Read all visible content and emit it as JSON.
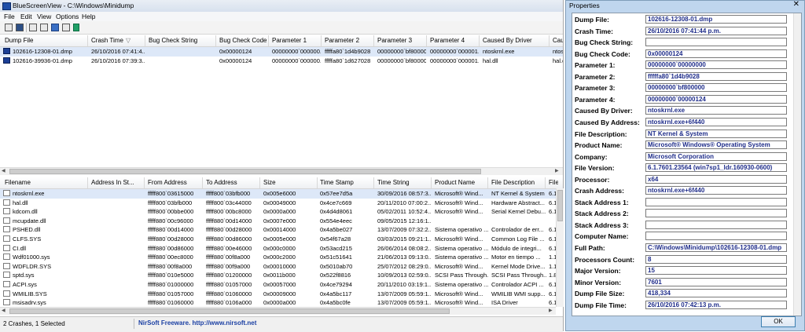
{
  "main_window": {
    "title": "BlueScreenView  -  C:\\Windows\\Minidump",
    "menu": [
      "File",
      "Edit",
      "View",
      "Options",
      "Help"
    ],
    "toolbar_icons": [
      "properties-icon",
      "save-icon",
      "html-report-icon",
      "copy-icon",
      "copy-files-icon",
      "refresh-icon",
      "exit-icon"
    ]
  },
  "crash_list": {
    "columns": [
      "Dump File",
      "Crash Time",
      "Bug Check String",
      "Bug Check Code",
      "Parameter 1",
      "Parameter 2",
      "Parameter 3",
      "Parameter 4",
      "Caused By Driver",
      "Caus"
    ],
    "rows": [
      [
        "102616-12308-01.dmp",
        "26/10/2016 07:41:4...",
        "",
        "0x00000124",
        "00000000`000000...",
        "fffffa80`1d4b9028",
        "00000000`bf800000",
        "00000000`000001...",
        "ntoskrnl.exe",
        "ntos"
      ],
      [
        "102616-39936-01.dmp",
        "26/10/2016 07:39:3...",
        "",
        "0x00000124",
        "00000000`000000...",
        "fffffa80`1d627028",
        "00000000`bf800000",
        "00000000`000001...",
        "hal.dll",
        "hal.d"
      ]
    ]
  },
  "driver_list": {
    "columns": [
      "Filename",
      "Address In St...",
      "From Address",
      "To Address",
      "Size",
      "Time Stamp",
      "Time String",
      "Product Name",
      "File Description",
      "File"
    ],
    "rows": [
      [
        "ntoskrnl.exe",
        "",
        "fffff800`03615000",
        "fffff800`03bfb000",
        "0x005e6000",
        "0x57ee7d5a",
        "30/09/2016 08:57:3...",
        "Microsoft® Wind...",
        "NT Kernel & System",
        "6.1.7"
      ],
      [
        "hal.dll",
        "",
        "fffff800`03bfb000",
        "fffff800`03c44000",
        "0x00049000",
        "0x4ce7c669",
        "20/11/2010 07:00:2...",
        "Microsoft® Wind...",
        "Hardware Abstract...",
        "6.1.7"
      ],
      [
        "kdcom.dll",
        "",
        "fffff800`00bbe000",
        "fffff800`00bc8000",
        "0x0000a000",
        "0x4d4d8061",
        "05/02/2011 10:52:4...",
        "Microsoft® Wind...",
        "Serial Kernel Debu...",
        "6.1.7"
      ],
      [
        "mcupdate.dll",
        "",
        "fffff880`00c96000",
        "fffff880`00d14000",
        "0x0007e000",
        "0x554e4eec",
        "09/05/2015 12:16:1...",
        "",
        "",
        ""
      ],
      [
        "PSHED.dll",
        "",
        "fffff880`00d14000",
        "fffff880`00d28000",
        "0x00014000",
        "0x4a5be027",
        "13/07/2009 07:32:2...",
        "Sistema operativo ...",
        "Controlador de err...",
        "6.1.7"
      ],
      [
        "CLFS.SYS",
        "",
        "fffff880`00d28000",
        "fffff880`00d86000",
        "0x0005e000",
        "0x54f67a28",
        "03/03/2015 09:21:1...",
        "Microsoft® Wind...",
        "Common Log File ...",
        "6.1.7"
      ],
      [
        "CI.dll",
        "",
        "fffff880`00d86000",
        "fffff880`00e46000",
        "0x000c0000",
        "0x53acd215",
        "26/06/2014 08:08:2...",
        "Sistema operativo ...",
        "Módulo de integri...",
        "6.1.7"
      ],
      [
        "Wdf01000.sys",
        "",
        "fffff880`00ec8000",
        "fffff880`00f8a000",
        "0x000c2000",
        "0x51c51641",
        "21/06/2013 09:13:0...",
        "Sistema operativo ...",
        "Motor en tiempo ...",
        "1.11."
      ],
      [
        "WDFLDR.SYS",
        "",
        "fffff880`00f8a000",
        "fffff880`00f9a000",
        "0x00010000",
        "0x5010ab70",
        "25/07/2012 08:29:0...",
        "Microsoft® Wind...",
        "Kernel Mode Drive...",
        "1.11."
      ],
      [
        "sptd.sys",
        "",
        "fffff880`010e5000",
        "fffff880`01200000",
        "0x0011b000",
        "0x522f8816",
        "10/09/2013 02:59:0...",
        "SCSI Pass Through...",
        "SCSI Pass Through...",
        "1.84."
      ],
      [
        "ACPI.sys",
        "",
        "fffff880`01000000",
        "fffff880`01057000",
        "0x00057000",
        "0x4ce79294",
        "20/11/2010 03:19:1...",
        "Sistema operativo ...",
        "Controlador ACPI ...",
        "6.1.7"
      ],
      [
        "WMILIB.SYS",
        "",
        "fffff880`01057000",
        "fffff880`01060000",
        "0x00009000",
        "0x4a5bc117",
        "13/07/2009 05:59:1...",
        "Microsoft® Wind...",
        "WMILIB WMI supp...",
        "6.1.7"
      ],
      [
        "msisadrv.sys",
        "",
        "fffff880`01060000",
        "fffff880`0106a000",
        "0x0000a000",
        "0x4a5bc0fe",
        "13/07/2009 05:59:1...",
        "Microsoft® Wind...",
        "ISA Driver",
        "6.1.7"
      ]
    ]
  },
  "status": {
    "left": "2 Crashes, 1 Selected",
    "center": "NirSoft Freeware.  http://www.nirsoft.net"
  },
  "properties": {
    "title": "Properties",
    "close_glyph": "✕",
    "ok_label": "OK",
    "fields": [
      {
        "label": "Dump File:",
        "value": "102616-12308-01.dmp"
      },
      {
        "label": "Crash Time:",
        "value": "26/10/2016 07:41:44 p.m."
      },
      {
        "label": "Bug Check String:",
        "value": ""
      },
      {
        "label": "Bug Check Code:",
        "value": "0x00000124"
      },
      {
        "label": "Parameter 1:",
        "value": "00000000`00000000"
      },
      {
        "label": "Parameter 2:",
        "value": "fffffa80`1d4b9028"
      },
      {
        "label": "Parameter 3:",
        "value": "00000000`bf800000"
      },
      {
        "label": "Parameter 4:",
        "value": "00000000`00000124"
      },
      {
        "label": "Caused By Driver:",
        "value": "ntoskrnl.exe"
      },
      {
        "label": "Caused By Address:",
        "value": "ntoskrnl.exe+6f440"
      },
      {
        "label": "File Description:",
        "value": "NT Kernel & System"
      },
      {
        "label": "Product Name:",
        "value": "Microsoft® Windows® Operating System"
      },
      {
        "label": "Company:",
        "value": "Microsoft Corporation"
      },
      {
        "label": "File Version:",
        "value": "6.1.7601.23564 (win7sp1_ldr.160930-0600)"
      },
      {
        "label": "Processor:",
        "value": "x64"
      },
      {
        "label": "Crash Address:",
        "value": "ntoskrnl.exe+6f440"
      },
      {
        "label": "Stack Address 1:",
        "value": ""
      },
      {
        "label": "Stack Address 2:",
        "value": ""
      },
      {
        "label": "Stack Address 3:",
        "value": ""
      },
      {
        "label": "Computer Name:",
        "value": ""
      },
      {
        "label": "Full Path:",
        "value": "C:\\Windows\\Minidump\\102616-12308-01.dmp"
      },
      {
        "label": "Processors Count:",
        "value": "8"
      },
      {
        "label": "Major Version:",
        "value": "15"
      },
      {
        "label": "Minor Version:",
        "value": "7601"
      },
      {
        "label": "Dump File Size:",
        "value": "418,334"
      },
      {
        "label": "Dump File Time:",
        "value": "26/10/2016 07:42:13 p.m."
      }
    ]
  }
}
